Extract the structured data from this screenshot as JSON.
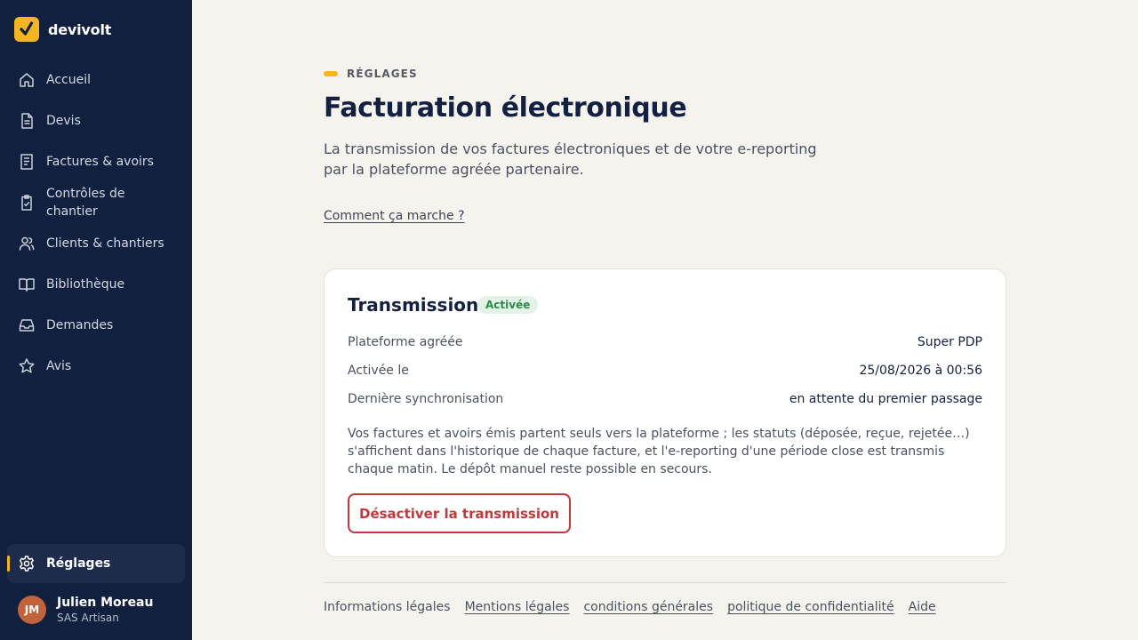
{
  "app": {
    "brand": "devivolt"
  },
  "sidebar": {
    "items": [
      {
        "label": "Accueil",
        "icon": "home-icon"
      },
      {
        "label": "Devis",
        "icon": "document-icon"
      },
      {
        "label": "Factures & avoirs",
        "icon": "invoice-icon"
      },
      {
        "label": "Contrôles de chantier",
        "icon": "clipboard-check-icon"
      },
      {
        "label": "Clients & chantiers",
        "icon": "users-icon"
      },
      {
        "label": "Bibliothèque",
        "icon": "book-icon"
      },
      {
        "label": "Demandes",
        "icon": "inbox-icon"
      },
      {
        "label": "Avis",
        "icon": "star-icon"
      }
    ],
    "settings": {
      "label": "Réglages",
      "icon": "gear-icon",
      "active": true
    },
    "user": {
      "initials": "JM",
      "name": "Julien Moreau",
      "company": "SAS Artisan"
    }
  },
  "page": {
    "eyebrow": "RÉGLAGES",
    "title": "Facturation électronique",
    "subtitle": "La transmission de vos factures électroniques et de votre e-reporting par la plateforme agréée partenaire.",
    "help_link": "Comment ça marche ?"
  },
  "card": {
    "title": "Transmission",
    "status": "Activée",
    "rows": [
      {
        "label": "Plateforme agréée",
        "value": "Super PDP"
      },
      {
        "label": "Activée le",
        "value": "25/08/2026 à 00:56"
      },
      {
        "label": "Dernière synchronisation",
        "value": "en attente du premier passage"
      }
    ],
    "note": "Vos factures et avoirs émis partent seuls vers la plateforme ; les statuts (déposée, reçue, rejetée…) s'affichent dans l'historique de chaque facture, et l'e-reporting d'une période close est transmis chaque matin. Le dépôt manuel reste possible en secours.",
    "deactivate_label": "Désactiver la transmission"
  },
  "footer": {
    "info": "Informations légales",
    "links": [
      "Mentions légales",
      "conditions générales",
      "politique de confidentialité",
      "Aide"
    ]
  },
  "colors": {
    "sidebar_bg": "#12203f",
    "accent": "#f5b421",
    "danger": "#c0393b",
    "success": "#2b8a4b",
    "page_bg": "#f5f3ee"
  }
}
